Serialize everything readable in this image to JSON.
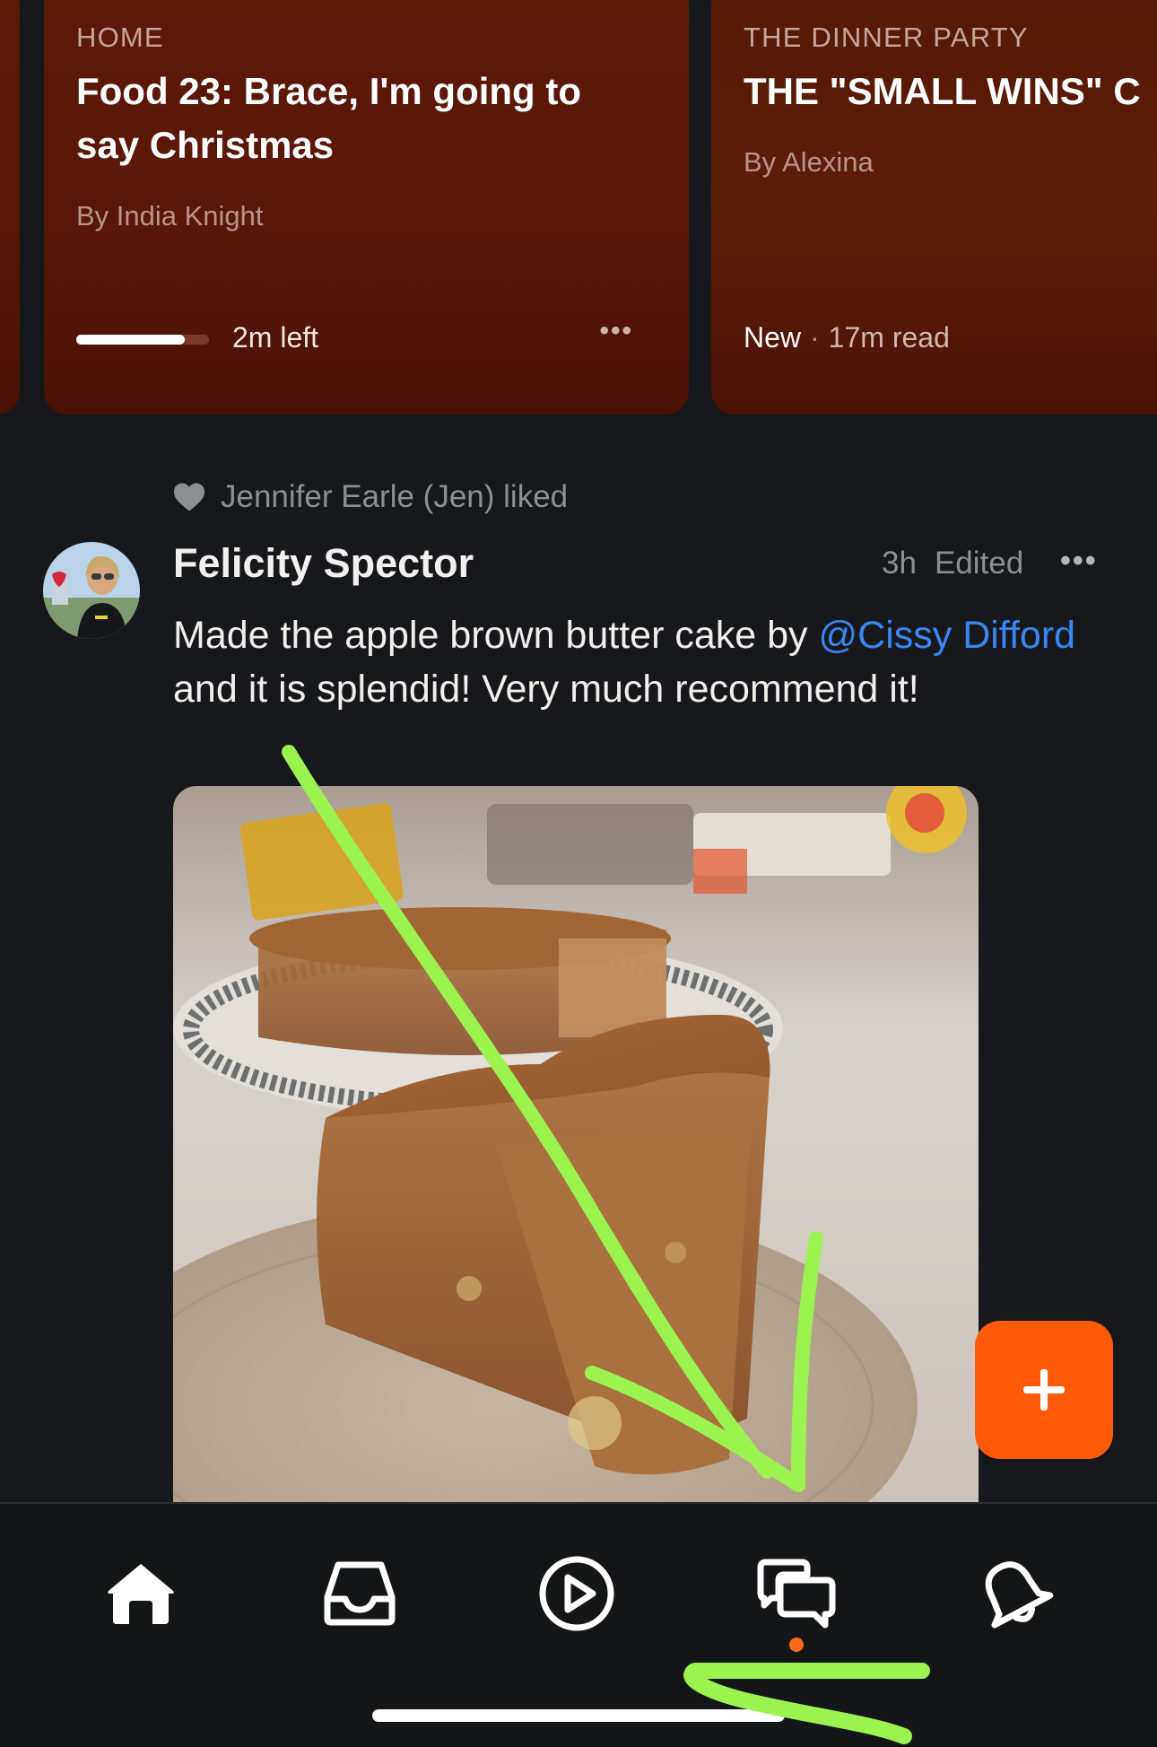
{
  "cards": [
    {
      "section": "HOME",
      "title": "Food 23: Brace, I'm going to say Christmas",
      "byline": "By India Knight",
      "progress": 0.82,
      "time_left": "2m left",
      "more_icon": "ellipsis-icon"
    },
    {
      "section": "THE DINNER PARTY",
      "title": "THE \"SMALL WINS\" C",
      "byline": "By Alexina",
      "status": "New",
      "separator": "·",
      "read_time": "17m read"
    }
  ],
  "activity": {
    "liked_by": "Jennifer Earle (Jen) liked",
    "heart_icon": "heart-icon"
  },
  "post": {
    "author": "Felicity Spector",
    "time": "3h",
    "edited": "Edited",
    "more": "•••",
    "text_before": "Made the apple brown butter cake by ",
    "mention": "@Cissy Difford",
    "text_after": " and it is splendid! Very much recommend it!",
    "image_alt": "apple brown butter cake photo"
  },
  "fab": {
    "icon": "plus-icon",
    "color": "#ff5a0a"
  },
  "tabbar": {
    "tabs": [
      {
        "name": "home",
        "icon": "home-icon",
        "active": true
      },
      {
        "name": "inbox",
        "icon": "inbox-icon"
      },
      {
        "name": "play",
        "icon": "play-icon"
      },
      {
        "name": "chat",
        "icon": "chat-icon",
        "badge": true
      },
      {
        "name": "activity",
        "icon": "bell-icon"
      }
    ]
  },
  "colors": {
    "background": "#16181b",
    "card": "#5a1707",
    "accent": "#ff5a0a",
    "link": "#3a86f2",
    "annotation": "#9cf34f"
  }
}
